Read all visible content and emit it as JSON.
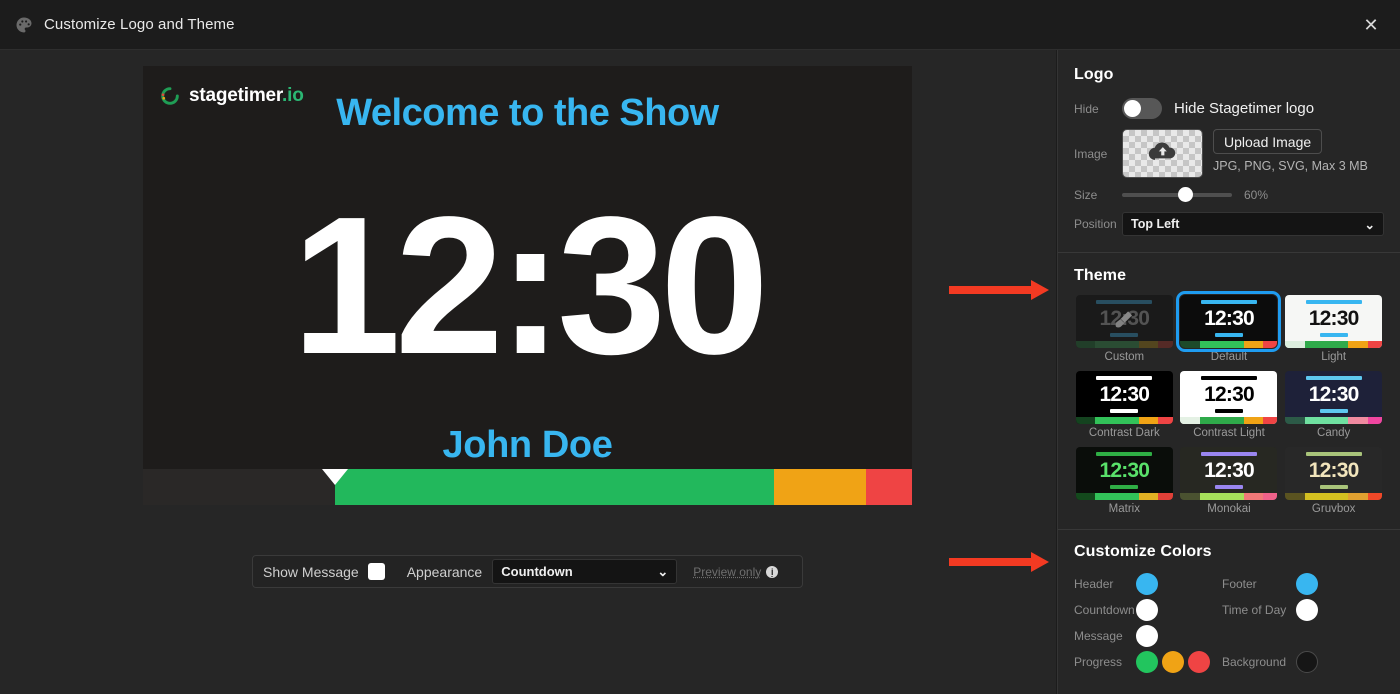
{
  "titlebar": {
    "icon": "palette-icon",
    "title": "Customize Logo and Theme",
    "close_label": "✕"
  },
  "preview": {
    "brand_name": "stagetimer",
    "brand_suffix": ".io",
    "header_text": "Welcome to the Show",
    "clock_text": "12:30",
    "footer_text": "John Doe",
    "header_color": "#38b6f0",
    "footer_color": "#38b6f0",
    "clock_color": "#ffffff",
    "background_color": "#1e1c1b",
    "progress": {
      "marker_position_pct": 25,
      "segments": [
        {
          "color": "#2a2827",
          "width_pct": 25
        },
        {
          "color": "#22b85c",
          "width_pct": 57
        },
        {
          "color": "#f0a315",
          "width_pct": 12
        },
        {
          "color": "#ef4444",
          "width_pct": 6
        }
      ]
    }
  },
  "controls": {
    "show_message_label": "Show Message",
    "appearance_label": "Appearance",
    "appearance_value": "Countdown",
    "preview_only_label": "Preview only",
    "info_glyph": "i"
  },
  "annotations": [
    {
      "name": "arrow-to-theme",
      "color": "#f33a22"
    },
    {
      "name": "arrow-to-customize-colors",
      "color": "#f33a22"
    }
  ],
  "panel": {
    "logo": {
      "title": "Logo",
      "hide_label": "Hide",
      "hide_toggle_text": "Hide Stagetimer logo",
      "hide_toggle_on": false,
      "image_label": "Image",
      "upload_button": "Upload Image",
      "upload_hint": "JPG, PNG, SVG, Max 3 MB",
      "size_label": "Size",
      "size_value": "60%",
      "position_label": "Position",
      "position_value": "Top Left"
    },
    "theme": {
      "title": "Theme",
      "selected": "Default",
      "items": [
        {
          "label": "Custom",
          "bg": "#0c0c0c",
          "header": "#2b7fa8",
          "clock": "#8a8a8a",
          "footer": "#2b7fa8",
          "dimmed": true,
          "brush": true,
          "bar": [
            {
              "color": "#1d5c2e",
              "width_pct": 20
            },
            {
              "color": "#2f7a44",
              "width_pct": 45
            },
            {
              "color": "#8a6b16",
              "width_pct": 20
            },
            {
              "color": "#8f3028",
              "width_pct": 15
            }
          ]
        },
        {
          "label": "Default",
          "bg": "#0c0c0c",
          "header": "#38b6f0",
          "clock": "#ffffff",
          "footer": "#38b6f0",
          "dimmed": false,
          "brush": false,
          "bar": [
            {
              "color": "#1d4a2a",
              "width_pct": 20
            },
            {
              "color": "#32c259",
              "width_pct": 45
            },
            {
              "color": "#f0a315",
              "width_pct": 20
            },
            {
              "color": "#ef4444",
              "width_pct": 15
            }
          ]
        },
        {
          "label": "Light",
          "bg": "#f6f7f5",
          "header": "#38b6f0",
          "clock": "#111111",
          "footer": "#38b6f0",
          "dimmed": false,
          "brush": false,
          "bar": [
            {
              "color": "#dceede",
              "width_pct": 20
            },
            {
              "color": "#2faa4a",
              "width_pct": 45
            },
            {
              "color": "#f0a315",
              "width_pct": 20
            },
            {
              "color": "#ef4444",
              "width_pct": 15
            }
          ]
        },
        {
          "label": "Contrast Dark",
          "bg": "#000000",
          "header": "#ffffff",
          "clock": "#ffffff",
          "footer": "#ffffff",
          "dimmed": false,
          "brush": false,
          "bar": [
            {
              "color": "#14431f",
              "width_pct": 20
            },
            {
              "color": "#32c259",
              "width_pct": 45
            },
            {
              "color": "#f0a315",
              "width_pct": 20
            },
            {
              "color": "#ef4444",
              "width_pct": 15
            }
          ]
        },
        {
          "label": "Contrast Light",
          "bg": "#ffffff",
          "header": "#000000",
          "clock": "#000000",
          "footer": "#000000",
          "dimmed": false,
          "brush": false,
          "bar": [
            {
              "color": "#e4f1e4",
              "width_pct": 20
            },
            {
              "color": "#2faa4a",
              "width_pct": 45
            },
            {
              "color": "#f0a315",
              "width_pct": 20
            },
            {
              "color": "#ef4444",
              "width_pct": 15
            }
          ]
        },
        {
          "label": "Candy",
          "bg": "#1e2139",
          "header": "#5ec8f0",
          "clock": "#ffffff",
          "footer": "#5ec8f0",
          "dimmed": false,
          "brush": false,
          "bar": [
            {
              "color": "#2c5a47",
              "width_pct": 20
            },
            {
              "color": "#6fe0a0",
              "width_pct": 45
            },
            {
              "color": "#f08aa0",
              "width_pct": 20
            },
            {
              "color": "#f046a0",
              "width_pct": 15
            }
          ]
        },
        {
          "label": "Matrix",
          "bg": "#0a0d0a",
          "header": "#2fae45",
          "clock": "#59e06a",
          "footer": "#2fae45",
          "dimmed": false,
          "brush": false,
          "bar": [
            {
              "color": "#13491c",
              "width_pct": 20
            },
            {
              "color": "#32c259",
              "width_pct": 45
            },
            {
              "color": "#e0b023",
              "width_pct": 20
            },
            {
              "color": "#e04038",
              "width_pct": 15
            }
          ]
        },
        {
          "label": "Monokai",
          "bg": "#272822",
          "header": "#9a86f0",
          "clock": "#ffffff",
          "footer": "#9a86f0",
          "dimmed": false,
          "brush": false,
          "bar": [
            {
              "color": "#4a5230",
              "width_pct": 20
            },
            {
              "color": "#a6e05a",
              "width_pct": 45
            },
            {
              "color": "#f07878",
              "width_pct": 20
            },
            {
              "color": "#f0628a",
              "width_pct": 15
            }
          ]
        },
        {
          "label": "Gruvbox",
          "bg": "#282828",
          "header": "#a9c47a",
          "clock": "#f2e5bc",
          "footer": "#a9c47a",
          "dimmed": false,
          "brush": false,
          "bar": [
            {
              "color": "#5a5320",
              "width_pct": 20
            },
            {
              "color": "#d4c020",
              "width_pct": 45
            },
            {
              "color": "#e0a030",
              "width_pct": 20
            },
            {
              "color": "#f04828",
              "width_pct": 15
            }
          ]
        }
      ]
    },
    "customize_colors": {
      "title": "Customize Colors",
      "rows": [
        {
          "left_label": "Header",
          "left_swatches": [
            "#38b6f0"
          ],
          "right_label": "Footer",
          "right_swatches": [
            "#38b6f0"
          ]
        },
        {
          "left_label": "Countdown",
          "left_swatches": [
            "#ffffff"
          ],
          "right_label": "Time of Day",
          "right_swatches": [
            "#ffffff"
          ]
        },
        {
          "left_label": "Message",
          "left_swatches": [
            "#ffffff"
          ],
          "right_label": "",
          "right_swatches": []
        },
        {
          "left_label": "Progress",
          "left_swatches": [
            "#22c55e",
            "#f0a315",
            "#ef4444"
          ],
          "right_label": "Background",
          "right_swatches": [
            "#161616"
          ]
        }
      ]
    }
  }
}
